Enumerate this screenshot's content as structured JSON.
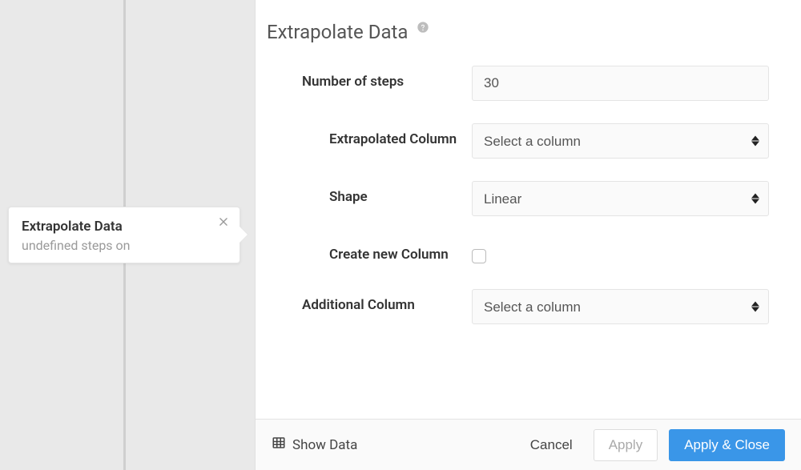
{
  "node_card": {
    "title": "Extrapolate Data",
    "subtitle": "undefined steps on"
  },
  "panel": {
    "title": "Extrapolate Data"
  },
  "form": {
    "number_of_steps": {
      "label": "Number of steps",
      "value": "30"
    },
    "extrapolated_column": {
      "label": "Extrapolated Column",
      "value": "Select a column"
    },
    "shape": {
      "label": "Shape",
      "value": "Linear"
    },
    "create_new_column": {
      "label": "Create new Column",
      "checked": false
    },
    "additional_column": {
      "label": "Additional Column",
      "value": "Select a column"
    }
  },
  "footer": {
    "show_data": "Show Data",
    "cancel": "Cancel",
    "apply": "Apply",
    "apply_close": "Apply & Close"
  }
}
